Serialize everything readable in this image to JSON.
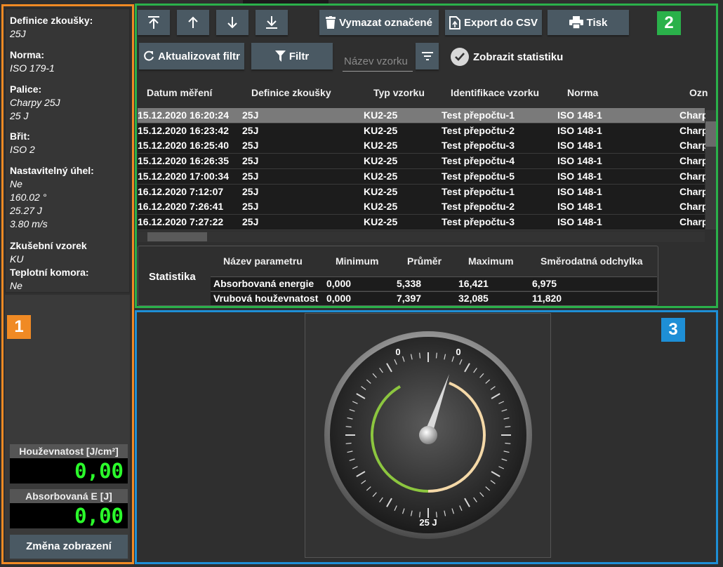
{
  "left_panel": {
    "items": [
      {
        "label": "Definice zkoušky:",
        "values": [
          "25J"
        ]
      },
      {
        "label": "Norma:",
        "values": [
          "ISO 179-1"
        ]
      },
      {
        "label": "Palice:",
        "values": [
          "Charpy 25J",
          "25 J"
        ]
      },
      {
        "label": "Břit:",
        "values": [
          "ISO 2"
        ]
      },
      {
        "label": "Nastavitelný úhel:",
        "values": [
          "Ne",
          "160.02 °",
          "25.27 J",
          "3.80 m/s"
        ]
      },
      {
        "label": "Zkušební vzorek",
        "values": [
          "KU"
        ]
      },
      {
        "label": "Teplotní komora:",
        "values": [
          "Ne"
        ]
      }
    ],
    "toughness": {
      "label": "Houževnatost [J/cm²]",
      "value": "0,00"
    },
    "absorbed": {
      "label": "Absorbovaná E [J]",
      "value": "0,00"
    },
    "change_view_label": "Změna zobrazení"
  },
  "region_tags": {
    "one": "1",
    "two": "2",
    "three": "3"
  },
  "toolbar": {
    "move_top_icon": "arrow-to-top",
    "move_up_icon": "arrow-up",
    "move_down_icon": "arrow-down",
    "move_bottom_icon": "arrow-to-bottom",
    "delete_label": "Vymazat označené",
    "export_label": "Export do CSV",
    "print_label": "Tisk",
    "refresh_label": "Aktualizovat filtr",
    "filter_label": "Filtr",
    "sample_placeholder": "Název vzorku",
    "show_stats_label": "Zobrazit statistiku"
  },
  "table": {
    "headers": [
      "Datum měření",
      "Definice zkoušky",
      "Typ vzorku",
      "Identifikace vzorku",
      "Norma",
      "Ozn"
    ],
    "rows": [
      [
        "15.12.2020 16:20:24",
        "25J",
        "KU2-25",
        "Test přepočtu-1",
        "ISO 148-1",
        "Charp"
      ],
      [
        "15.12.2020 16:23:42",
        "25J",
        "KU2-25",
        "Test přepočtu-2",
        "ISO 148-1",
        "Charp"
      ],
      [
        "15.12.2020 16:25:40",
        "25J",
        "KU2-25",
        "Test přepočtu-3",
        "ISO 148-1",
        "Charp"
      ],
      [
        "15.12.2020 16:26:35",
        "25J",
        "KU2-25",
        "Test přepočtu-4",
        "ISO 148-1",
        "Charp"
      ],
      [
        "15.12.2020 17:00:34",
        "25J",
        "KU2-25",
        "Test přepočtu-5",
        "ISO 148-1",
        "Charp"
      ],
      [
        "16.12.2020 7:12:07",
        "25J",
        "KU2-25",
        "Test přepočtu-1",
        "ISO 148-1",
        "Charp"
      ],
      [
        "16.12.2020 7:26:41",
        "25J",
        "KU2-25",
        "Test přepočtu-2",
        "ISO 148-1",
        "Charp"
      ],
      [
        "16.12.2020 7:27:22",
        "25J",
        "KU2-25",
        "Test přepočtu-3",
        "ISO 148-1",
        "Charp"
      ]
    ],
    "selected_row": 0
  },
  "statistics": {
    "title": "Statistika",
    "headers": [
      "Název parametru",
      "Minimum",
      "Průměr",
      "Maximum",
      "Směrodatná odchylka"
    ],
    "rows": [
      [
        "Absorbovaná energie",
        "0,000",
        "5,338",
        "16,421",
        "6,975"
      ],
      [
        "Vrubová houževnatost",
        "0,000",
        "7,397",
        "32,085",
        "11,820"
      ]
    ]
  },
  "gauge": {
    "label_left": "0",
    "label_right": "0",
    "bottom_label": "25 J",
    "accent_green": "#8cc63f",
    "accent_beige": "#f5d9a8"
  },
  "colors": {
    "region1": "#f08a24",
    "region2": "#2ab14a",
    "region3": "#1e8fd6",
    "button": "#4a5963",
    "digit": "#2bff2b"
  }
}
